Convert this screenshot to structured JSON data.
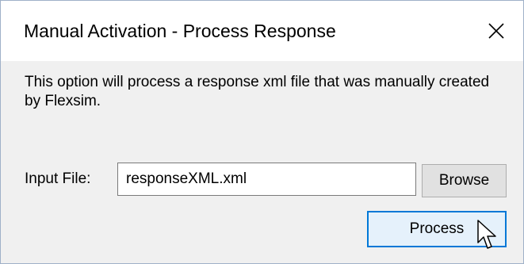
{
  "dialog": {
    "title": "Manual Activation - Process Response",
    "message": "This option will process a response xml file that was manually created by Flexsim.",
    "input_label": "Input File:",
    "input_value": "responseXML.xml",
    "browse_label": "Browse",
    "process_label": "Process"
  },
  "icons": {
    "close": "close-icon",
    "cursor": "mouse-pointer-icon"
  },
  "colors": {
    "focus_border": "#0078d7",
    "button_face": "#e1e1e1",
    "dialog_body": "#f0f0f0"
  }
}
